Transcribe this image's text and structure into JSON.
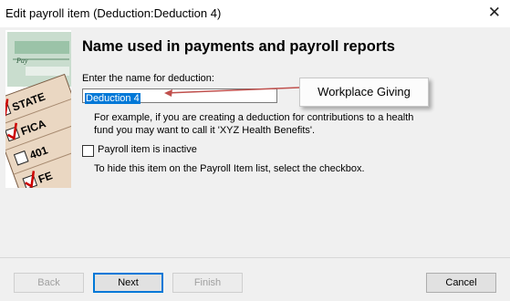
{
  "window": {
    "title": "Edit payroll item (Deduction:Deduction 4)",
    "close_glyph": "✕"
  },
  "art": {
    "labels": [
      "STATE",
      "FICA",
      "401",
      "FE"
    ],
    "check_text": "Pay"
  },
  "form": {
    "heading": "Name used in payments and payroll reports",
    "prompt": "Enter the name for deduction:",
    "name_value": "Deduction 4",
    "callout": "Workplace Giving",
    "example": "For example, if you are creating a deduction for contributions to a health fund you may want to call it 'XYZ Health Benefits'.",
    "inactive_checkbox_label": "Payroll item is inactive",
    "inactive_checked": false,
    "hide_hint": "To hide this item on the Payroll Item list, select the checkbox."
  },
  "buttons": {
    "back": "Back",
    "next": "Next",
    "finish": "Finish",
    "cancel": "Cancel"
  },
  "colors": {
    "selection": "#0078d7",
    "callout_arrow": "#c0504d",
    "art_green": "#9bc3a8",
    "check_red": "#cc0000"
  }
}
